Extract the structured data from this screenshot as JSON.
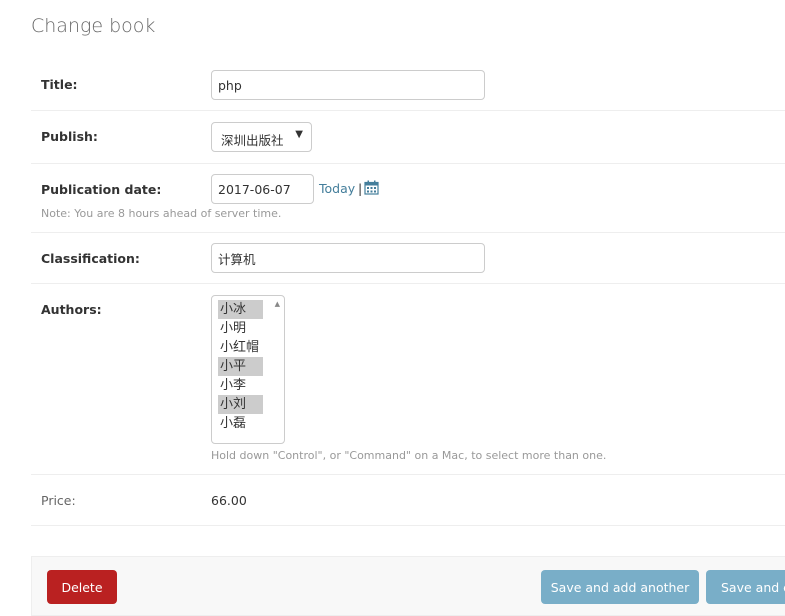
{
  "page": {
    "title": "Change book"
  },
  "fields": {
    "title": {
      "label": "Title:",
      "value": "php"
    },
    "publish": {
      "label": "Publish:",
      "selected": "深圳出版社"
    },
    "pub_date": {
      "label": "Publication date:",
      "value": "2017-06-07",
      "today_link": "Today",
      "separator": "|",
      "note": "Note: You are 8 hours ahead of server time."
    },
    "classification": {
      "label": "Classification:",
      "value": "计算机"
    },
    "authors": {
      "label": "Authors:",
      "options": [
        {
          "label": "小冰",
          "selected": true
        },
        {
          "label": "小明",
          "selected": false
        },
        {
          "label": "小红帽",
          "selected": false
        },
        {
          "label": "小平",
          "selected": true
        },
        {
          "label": "小李",
          "selected": false
        },
        {
          "label": "小刘",
          "selected": true
        },
        {
          "label": "小磊",
          "selected": false
        }
      ],
      "help": "Hold down \"Control\", or \"Command\" on a Mac, to select more than one."
    },
    "price": {
      "label": "Price:",
      "value": "66.00"
    }
  },
  "actions": {
    "delete_label": "Delete",
    "save_add_another_label": "Save and add another",
    "save_continue_label": "Save and co"
  },
  "colors": {
    "delete": "#ba2121",
    "save": "#79aec8",
    "link": "#447e9b",
    "selected_option": "#cccccc"
  },
  "icons": {
    "date_picker": "calendar-icon",
    "select_caret": "chevron-down-icon"
  }
}
